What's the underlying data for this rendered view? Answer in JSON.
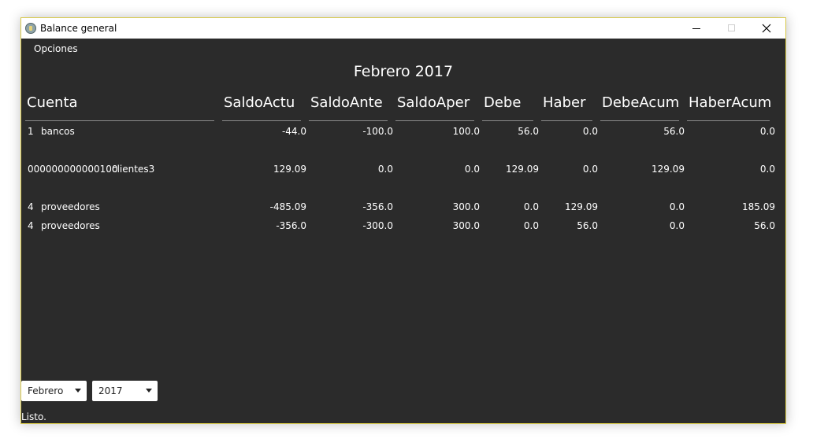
{
  "window": {
    "title": "Balance general"
  },
  "menu": {
    "opciones": "Opciones"
  },
  "heading": "Febrero 2017",
  "table": {
    "columns": [
      "Cuenta",
      "SaldoActu",
      "SaldoAnte",
      "SaldoAper",
      "Debe",
      "Haber",
      "DebeAcum",
      "HaberAcum"
    ],
    "rows": [
      {
        "code": "1",
        "name": "bancos",
        "values": [
          "-44.0",
          "-100.0",
          "100.0",
          "56.0",
          "0.0",
          "56.0",
          "0.0"
        ]
      },
      {
        "code": "000000000000100",
        "name": "clientes3",
        "values": [
          "129.09",
          "0.0",
          "0.0",
          "129.09",
          "0.0",
          "129.09",
          "0.0"
        ]
      },
      {
        "code": "4",
        "name": "proveedores",
        "values": [
          "-485.09",
          "-356.0",
          "300.0",
          "0.0",
          "129.09",
          "0.0",
          "185.09"
        ]
      },
      {
        "code": "4",
        "name": "proveedores",
        "values": [
          "-356.0",
          "-300.0",
          "300.0",
          "0.0",
          "56.0",
          "0.0",
          "56.0"
        ]
      }
    ]
  },
  "controls": {
    "month": "Febrero",
    "year": "2017"
  },
  "status": "Listo.",
  "icons": {
    "app": "app-icon",
    "minimize": "minimize-icon",
    "maximize": "maximize-icon",
    "close": "close-icon",
    "dropdown": "chevron-down-icon"
  },
  "colors": {
    "background": "#2b2b2b",
    "text": "#ffffff",
    "window_border": "#d8c94a"
  }
}
